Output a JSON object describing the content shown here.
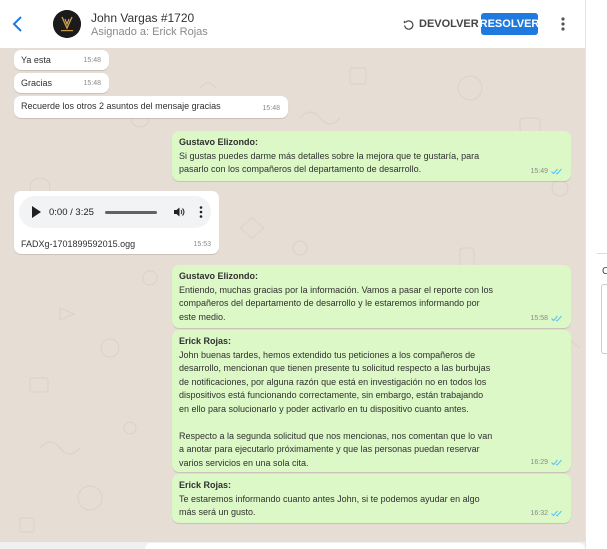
{
  "header": {
    "contact_name": "John Vargas #1720",
    "assigned_to": "Asignado a: Erick Rojas",
    "return_label": "DEVOLVER",
    "resolve_label": "RESOLVER",
    "accent_color": "#1f7ae0"
  },
  "messages": [
    {
      "direction": "in",
      "text": "Ya esta",
      "time": "15:48"
    },
    {
      "direction": "in",
      "text": "Gracias",
      "time": "15:48"
    },
    {
      "direction": "in",
      "text": "Recuerde los otros 2 asuntos del mensaje gracias",
      "time": "15:48"
    },
    {
      "direction": "out",
      "author": "Gustavo Elizondo:",
      "text": "Si gustas puedes darme más detalles sobre la mejora que te gustaría, para\npasarlo con los compañeros del departamento de desarrollo.",
      "time": "15:49",
      "status": "read"
    },
    {
      "direction": "in",
      "type": "audio",
      "audio_time": "0:00 / 3:25",
      "filename": "FADXg-1701899592015.ogg",
      "time": "15:53"
    },
    {
      "direction": "out",
      "author": "Gustavo Elizondo:",
      "text": "Entiendo, muchas gracias por la información. Vamos a pasar el reporte con los\ncompañeros del departamento de desarrollo y le estaremos informando por\neste medio.",
      "time": "15:58",
      "status": "read"
    },
    {
      "direction": "out",
      "author": "Erick Rojas:",
      "text": "John buenas tardes, hemos extendido tus peticiones a los compañeros de\ndesarrollo, mencionan que tienen presente tu solicitud respecto a las burbujas\nde notificaciones, por alguna razón que está en investigación no en todos los\ndispositivos está funcionando correctamente, sin embargo, están trabajando\nen ello para solucionarlo y poder activarlo en tu dispositivo cuanto antes.\n\nRespecto a la segunda solicitud que nos mencionas, nos comentan que lo van\na anotar para ejecutarlo próximamente y que las personas puedan reservar\nvarios servicios en una sola cita.",
      "time": "16:29",
      "status": "read"
    },
    {
      "direction": "out",
      "author": "Erick Rojas:",
      "text": "Te estaremos informando cuanto antes John, si te podemos ayudar en algo\nmás será un gusto.",
      "time": "16:32",
      "status": "read"
    }
  ],
  "right_panel": {
    "letter": "C"
  },
  "colors": {
    "chat_bg": "#e6ddd4",
    "bubble_out": "#dcf8c6",
    "bubble_in": "#ffffff",
    "read_check": "#4fc3f7"
  }
}
